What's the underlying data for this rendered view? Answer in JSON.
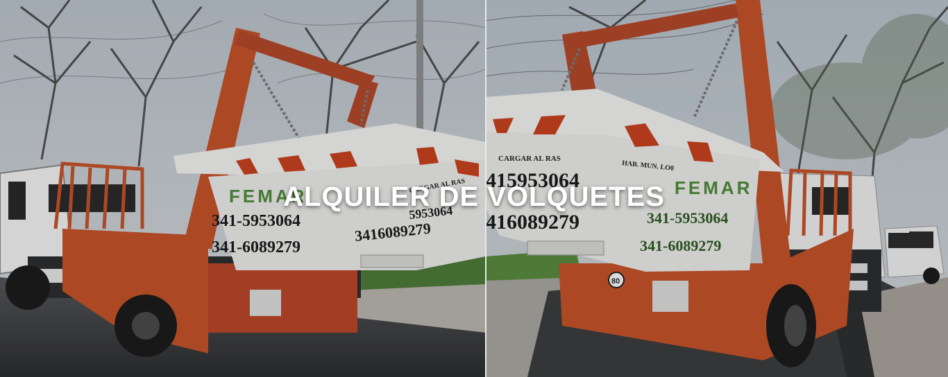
{
  "hero": {
    "title": "ALQUILER DE VOLQUETES"
  },
  "photo_left": {
    "brand": "FEMAR",
    "phone_1": "341-5953064",
    "phone_2": "341-6089279",
    "side_text": "CARGAR AL RAS",
    "side_phone": "3416089279",
    "side_phone_top": "5953064"
  },
  "photo_right": {
    "brand": "FEMAR",
    "phone_1": "341-5953064",
    "phone_2": "341-6089279",
    "cargar_text": "CARGAR AL RAS",
    "hab_text": "HAB. MUN. LO0",
    "big_phone_1": "415953064",
    "big_phone_2": "416089279",
    "speed_sign": "80"
  },
  "colors": {
    "truck_orange": "#c4522a",
    "skip_white": "#eeeeec",
    "stripe_red": "#c8431f",
    "sky": "#c9d0d6",
    "road": "#3c3d3f",
    "brand_green": "#4e8a3a"
  }
}
